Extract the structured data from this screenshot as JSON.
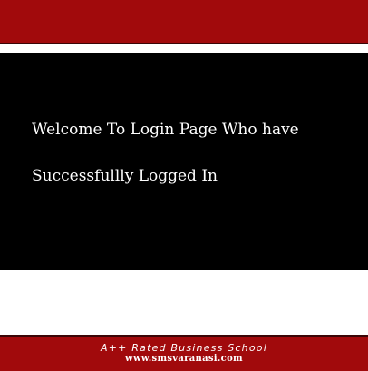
{
  "main": {
    "welcome_line_1": "Welcome To Login Page Who have",
    "welcome_line_2": "Successfullly Logged In"
  },
  "footer": {
    "tagline": "A++ Rated Business School",
    "website": "www.smsvaranasi.com"
  },
  "colors": {
    "brand_red": "#a10a0c",
    "panel_black": "#000000",
    "text_white": "#ffffff"
  }
}
